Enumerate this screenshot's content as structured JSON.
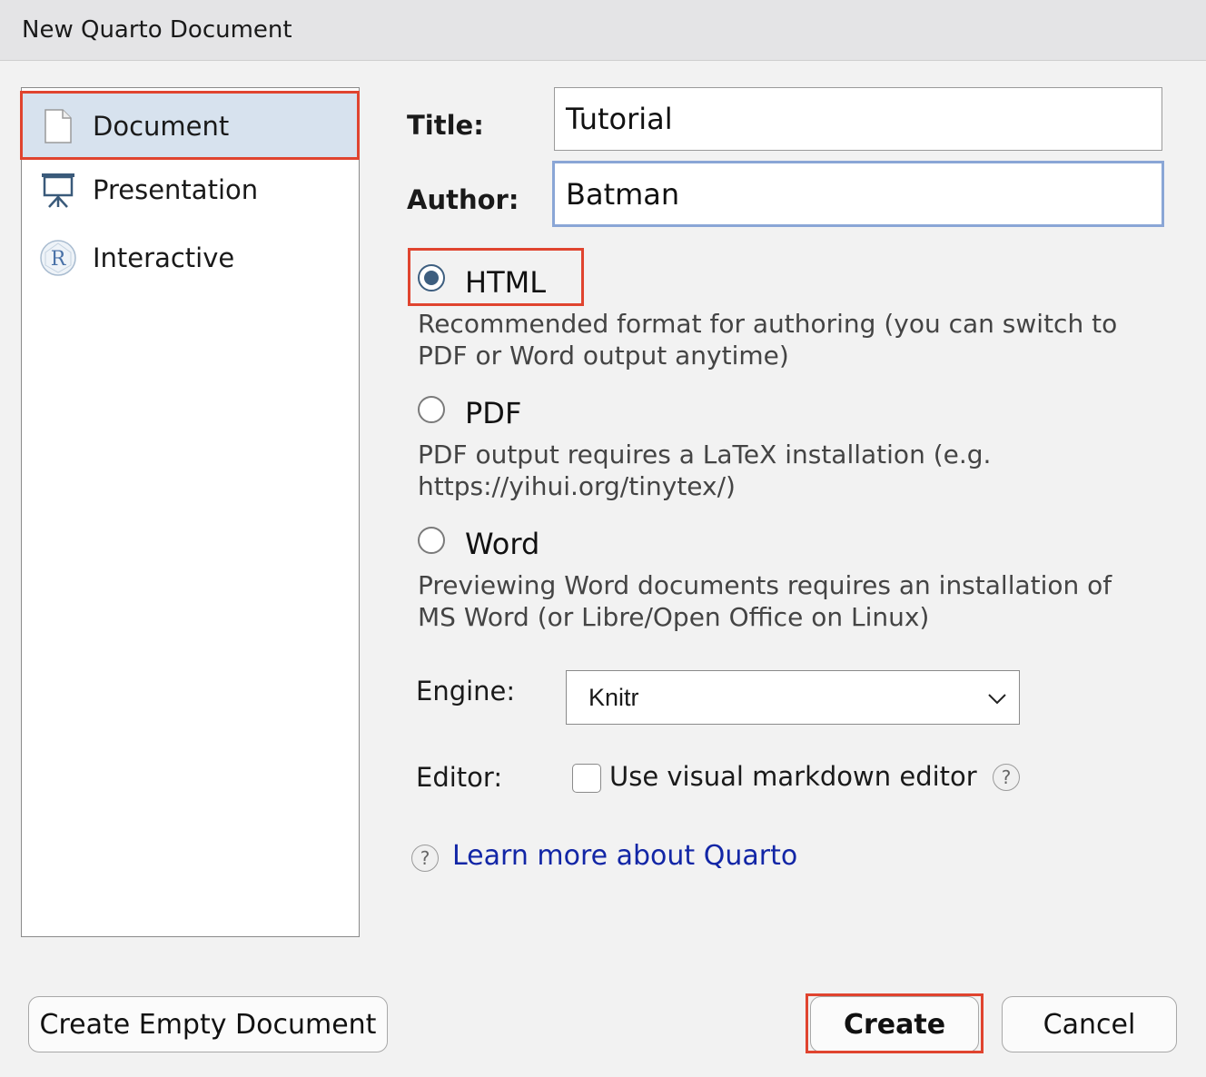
{
  "dialog": {
    "title": "New Quarto Document"
  },
  "sidebar": {
    "items": [
      {
        "label": "Document",
        "icon": "document-icon",
        "selected": true
      },
      {
        "label": "Presentation",
        "icon": "presentation-icon",
        "selected": false
      },
      {
        "label": "Interactive",
        "icon": "r-logo-icon",
        "selected": false
      }
    ]
  },
  "form": {
    "title_label": "Title:",
    "title_value": "Tutorial",
    "author_label": "Author:",
    "author_value": "Batman",
    "formats": [
      {
        "label": "HTML",
        "selected": true,
        "description_lines": [
          "Recommended format for authoring (you can switch to",
          "PDF or Word output anytime)"
        ]
      },
      {
        "label": "PDF",
        "selected": false,
        "description_lines": [
          "PDF output requires a LaTeX installation (e.g.",
          "https://yihui.org/tinytex/)"
        ]
      },
      {
        "label": "Word",
        "selected": false,
        "description_lines": [
          "Previewing Word documents requires an installation of",
          "MS Word (or Libre/Open Office on Linux)"
        ]
      }
    ],
    "engine_label": "Engine:",
    "engine_value": "Knitr",
    "editor_label": "Editor:",
    "visual_editor_label": "Use visual markdown editor",
    "visual_editor_checked": false,
    "help_glyph": "?",
    "learn_more": "Learn more about Quarto"
  },
  "buttons": {
    "create_empty": "Create Empty Document",
    "create": "Create",
    "cancel": "Cancel"
  },
  "colors": {
    "highlight_box": "#e0442f",
    "selected_row": "#d7e2ee",
    "link": "#1226a6",
    "radio_selected": "#3d5e7f"
  }
}
